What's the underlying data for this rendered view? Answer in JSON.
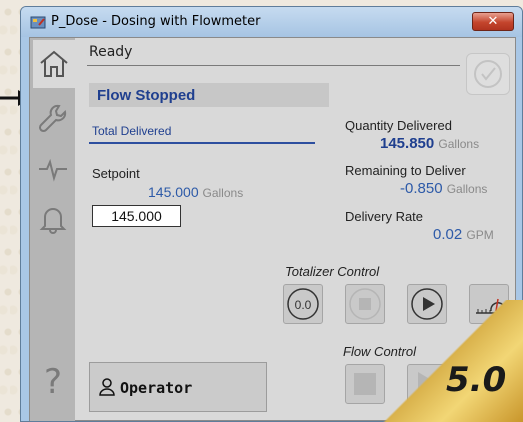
{
  "window": {
    "title": "P_Dose - Dosing with Flowmeter",
    "close_glyph": "✕"
  },
  "nav": {
    "items": [
      {
        "name": "home",
        "icon": "home-icon",
        "active": true
      },
      {
        "name": "maintenance",
        "icon": "wrench-icon",
        "active": false
      },
      {
        "name": "trends",
        "icon": "pulse-icon",
        "active": false
      },
      {
        "name": "alarms",
        "icon": "bell-icon",
        "active": false
      },
      {
        "name": "help",
        "icon": "question-icon",
        "active": false
      }
    ],
    "help_glyph": "?"
  },
  "status": {
    "text": "Ready"
  },
  "flow": {
    "state": "Flow Stopped",
    "total_delivered_label": "Total Delivered"
  },
  "setpoint": {
    "label": "Setpoint",
    "value": "145.000",
    "unit": "Gallons",
    "input_value": "145.000"
  },
  "quantity": {
    "label": "Quantity Delivered",
    "value": "145.850",
    "unit": "Gallons"
  },
  "remaining": {
    "label": "Remaining to Deliver",
    "value": "-0.850",
    "unit": "Gallons"
  },
  "rate": {
    "label": "Delivery Rate",
    "value": "0.02",
    "unit": "GPM"
  },
  "totalizer": {
    "label": "Totalizer Control",
    "reset_glyph": "0.0"
  },
  "flow_control": {
    "label": "Flow Control"
  },
  "operator": {
    "label": "Operator"
  },
  "badge": {
    "version": "5.0"
  },
  "colors": {
    "accent_blue": "#1f3f8f",
    "value_blue": "#2d5aa8",
    "close_red": "#c4452d",
    "badge_gold": "#e6c55a"
  }
}
